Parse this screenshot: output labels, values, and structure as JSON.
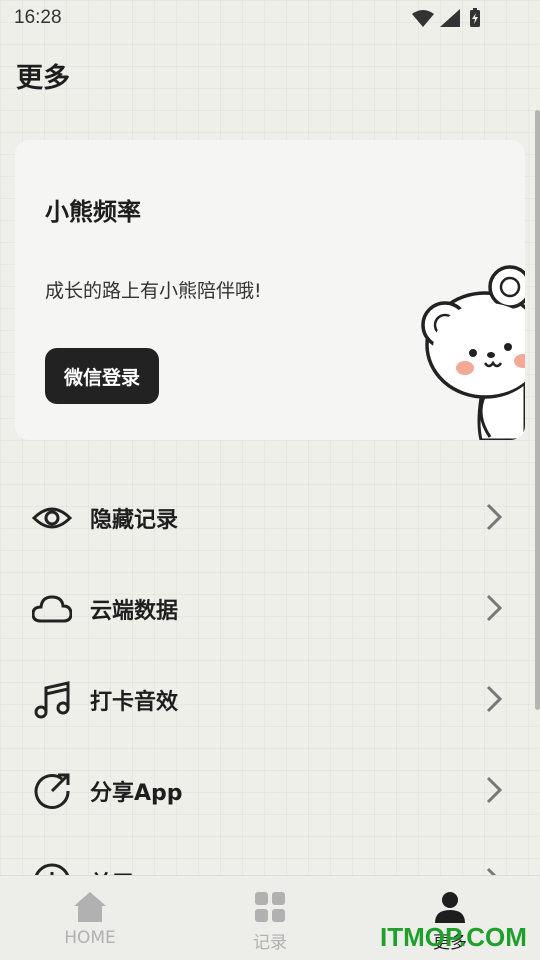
{
  "status_bar": {
    "time": "16:28",
    "icons": [
      "wifi-icon",
      "signal-icon",
      "battery-icon"
    ]
  },
  "page": {
    "title": "更多"
  },
  "profile_card": {
    "title": "小熊频率",
    "subtitle": "成长的路上有小熊陪伴哦!",
    "login_button": "微信登录"
  },
  "menu": {
    "items": [
      {
        "label": "隐藏记录",
        "icon": "eye-icon"
      },
      {
        "label": "云端数据",
        "icon": "cloud-icon"
      },
      {
        "label": "打卡音效",
        "icon": "music-note-icon"
      },
      {
        "label": "分享App",
        "icon": "share-icon"
      },
      {
        "label": "关于",
        "icon": "info-icon"
      }
    ]
  },
  "bottom_nav": {
    "items": [
      {
        "label": "HOME",
        "icon": "home-icon",
        "active": false
      },
      {
        "label": "记录",
        "icon": "grid-icon",
        "active": false
      },
      {
        "label": "更多",
        "icon": "person-icon",
        "active": true
      }
    ]
  },
  "watermark": "ITMOP.COM",
  "colors": {
    "background": "#efefe9",
    "button": "#222222",
    "inactive_nav": "#b1b1b1",
    "watermark": "#1fa02a"
  }
}
